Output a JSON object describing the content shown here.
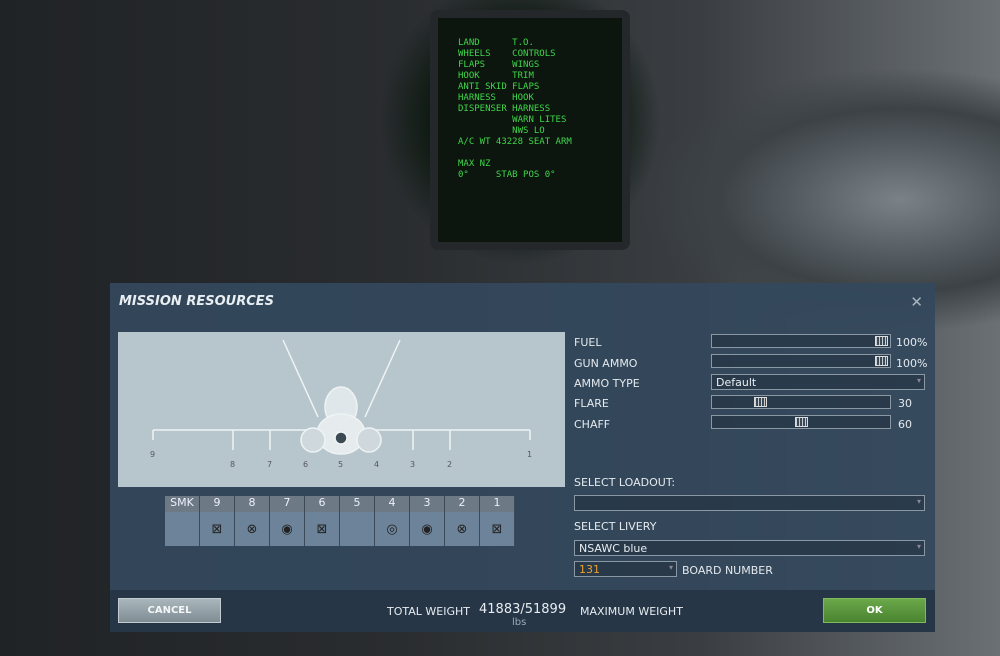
{
  "background": {
    "mfd_lines": [
      "LAND      T.O.",
      "WHEELS    CONTROLS",
      "FLAPS     WINGS",
      "HOOK      TRIM",
      "ANTI SKID FLAPS",
      "HARNESS   HOOK",
      "DISPENSER HARNESS",
      "          WARN LITES",
      "          NWS LO",
      "A/C WT 43228 SEAT ARM",
      "",
      "MAX NZ",
      "0°     STAB POS 0°"
    ]
  },
  "dialog": {
    "title": "MISSION RESOURCES",
    "close_icon": "close-icon"
  },
  "aircraft_stations": [
    "9",
    "8",
    "7",
    "6",
    "5",
    "4",
    "3",
    "2",
    "1"
  ],
  "pylons": [
    {
      "label": "SMK",
      "icon": ""
    },
    {
      "label": "9",
      "icon": "⊠"
    },
    {
      "label": "8",
      "icon": "⊗"
    },
    {
      "label": "7",
      "icon": "◉"
    },
    {
      "label": "6",
      "icon": "⊠"
    },
    {
      "label": "5",
      "icon": ""
    },
    {
      "label": "4",
      "icon": "◎"
    },
    {
      "label": "3",
      "icon": "◉"
    },
    {
      "label": "2",
      "icon": "⊗"
    },
    {
      "label": "1",
      "icon": "⊠"
    }
  ],
  "resources": {
    "fuel": {
      "label": "FUEL",
      "value": "100%",
      "fraction": 1.0
    },
    "gun_ammo": {
      "label": "GUN AMMO",
      "value": "100%",
      "fraction": 1.0
    },
    "ammo_type": {
      "label": "AMMO TYPE",
      "value": "Default"
    },
    "flare": {
      "label": "FLARE",
      "value": "30",
      "fraction": 0.25
    },
    "chaff": {
      "label": "CHAFF",
      "value": "60",
      "fraction": 0.5
    }
  },
  "loadout": {
    "label": "SELECT LOADOUT:",
    "value": ""
  },
  "livery": {
    "label": "SELECT LIVERY",
    "value": "NSAWC blue"
  },
  "board": {
    "value": "131",
    "label": "BOARD NUMBER"
  },
  "footer": {
    "cancel": "CANCEL",
    "total_weight_label": "TOTAL WEIGHT",
    "weight": "41883/51899",
    "unit": "lbs",
    "max_label": "MAXIMUM WEIGHT",
    "ok": "OK"
  },
  "colors": {
    "ok": "#5a9a3c",
    "board_number": "#e8a030"
  }
}
